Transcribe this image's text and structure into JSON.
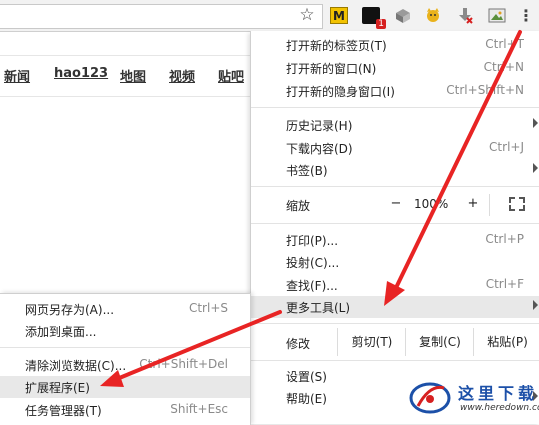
{
  "toolbar": {
    "ext_m_label": "M",
    "ext_badge": "1",
    "menu_icon": "⋮",
    "star_icon": "☆"
  },
  "page": {
    "nav_links": [
      "新闻",
      "hao123",
      "地图",
      "视频",
      "贴吧"
    ]
  },
  "main_menu": {
    "new_tab": {
      "label": "打开新的标签页(T)",
      "shortcut": "Ctrl+T"
    },
    "new_window": {
      "label": "打开新的窗口(N)",
      "shortcut": "Ctrl+N"
    },
    "incognito": {
      "label": "打开新的隐身窗口(I)",
      "shortcut": "Ctrl+Shift+N"
    },
    "history": {
      "label": "历史记录(H)"
    },
    "downloads": {
      "label": "下载内容(D)",
      "shortcut": "Ctrl+J"
    },
    "bookmarks": {
      "label": "书签(B)"
    },
    "zoom": {
      "label": "缩放",
      "minus": "−",
      "value": "100%",
      "plus": "+"
    },
    "print": {
      "label": "打印(P)...",
      "shortcut": "Ctrl+P"
    },
    "cast": {
      "label": "投射(C)..."
    },
    "find": {
      "label": "查找(F)...",
      "shortcut": "Ctrl+F"
    },
    "more_tools": {
      "label": "更多工具(L)"
    },
    "edit": {
      "label": "修改",
      "cut": "剪切(T)",
      "copy": "复制(C)",
      "paste": "粘贴(P)"
    },
    "settings": {
      "label": "设置(S)"
    },
    "help": {
      "label": "帮助(E)"
    }
  },
  "sub_menu": {
    "save_as": {
      "label": "网页另存为(A)...",
      "shortcut": "Ctrl+S"
    },
    "add_to_desktop": {
      "label": "添加到桌面..."
    },
    "clear_data": {
      "label": "清除浏览数据(C)...",
      "shortcut": "Ctrl+Shift+Del"
    },
    "extensions": {
      "label": "扩展程序(E)"
    },
    "task_manager": {
      "label": "任务管理器(T)",
      "shortcut": "Shift+Esc"
    }
  },
  "watermark": {
    "text": "这里下载",
    "url": "www.heredown.com"
  },
  "colors": {
    "highlight": "#e8e8e8",
    "arrow": "#e82424",
    "watermark_blue": "#1c50a8"
  }
}
